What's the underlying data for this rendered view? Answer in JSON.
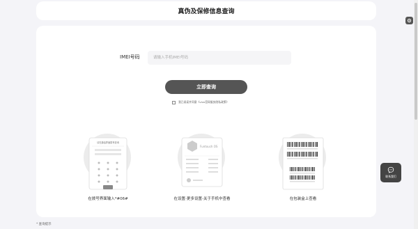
{
  "header": {
    "title": "真伪及保修信息查询"
  },
  "form": {
    "imei_label": "IMEI号码",
    "imei_placeholder": "请输入手机IMEI号码",
    "query_button": "立即查询",
    "agree_text": "我已阅读并同意《vivo官网服务隐私政策》"
  },
  "guides": [
    {
      "caption": "在拨号界面输入*#06#",
      "phone_header": "请在通话界面拨号查询"
    },
    {
      "caption": "在设置-更多设置-关于手机中查看",
      "device_label": "Funtouch OS"
    },
    {
      "caption": "在包装盒上查看"
    }
  ],
  "footer": {
    "note": "* 查询提示"
  },
  "contact": {
    "label": "联系我们"
  },
  "icons": [
    "gear-icon",
    "chat-icon",
    "phone-icon",
    "device-icon",
    "barcode-icon"
  ]
}
